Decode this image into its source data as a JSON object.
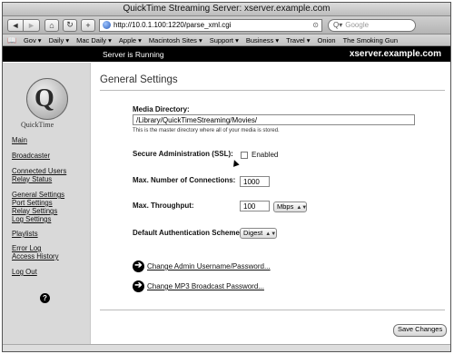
{
  "window": {
    "title": "QuickTime Streaming Server: xserver.example.com"
  },
  "toolbar": {
    "back_icon": "◄",
    "forward_icon": "►",
    "home_icon": "⌂",
    "reload_icon": "↻",
    "add_icon": "+",
    "url": "http://10.0.1.100:1220/parse_xml.cgi",
    "refresh_icon": "⊙",
    "search_placeholder": "Google",
    "search_icon": "Q▾"
  },
  "bookmarks": {
    "icon": "📖",
    "items": [
      "Gov ▾",
      "Daily ▾",
      "Mac Daily ▾",
      "Apple ▾",
      "Macintosh Sites ▾",
      "Support ▾",
      "Business ▾",
      "Travel ▾",
      "Onion",
      "The Smoking Gun"
    ]
  },
  "header": {
    "status": "Server is Running",
    "host": "xserver.example.com"
  },
  "sidebar": {
    "logo_text": "QuickTime",
    "items": [
      "Main",
      "Broadcaster",
      "Connected Users",
      "Relay Status",
      "General Settings",
      "Port Settings",
      "Relay Settings",
      "Log Settings",
      "Playlists",
      "Error Log",
      "Access History",
      "Log Out"
    ],
    "help_icon": "?"
  },
  "main": {
    "title": "General Settings",
    "media_dir_label": "Media Directory:",
    "media_dir_value": "/Library/QuickTimeStreaming/Movies/",
    "media_dir_hint": "This is the master directory where all of your media is stored.",
    "ssl_label": "Secure Administration (SSL):",
    "ssl_enabled_label": "Enabled",
    "ssl_enabled": false,
    "max_conn_label": "Max. Number of Connections:",
    "max_conn_value": "1000",
    "max_throughput_label": "Max. Throughput:",
    "max_throughput_value": "100",
    "throughput_unit": "Mbps",
    "auth_label": "Default Authentication Scheme:",
    "auth_value": "Digest",
    "change_admin_link": "Change Admin Username/Password...",
    "change_mp3_link": "Change MP3 Broadcast Password...",
    "save_button": "Save Changes",
    "arrow_icon": "➔",
    "select_arrow_icon": "▲▼"
  }
}
